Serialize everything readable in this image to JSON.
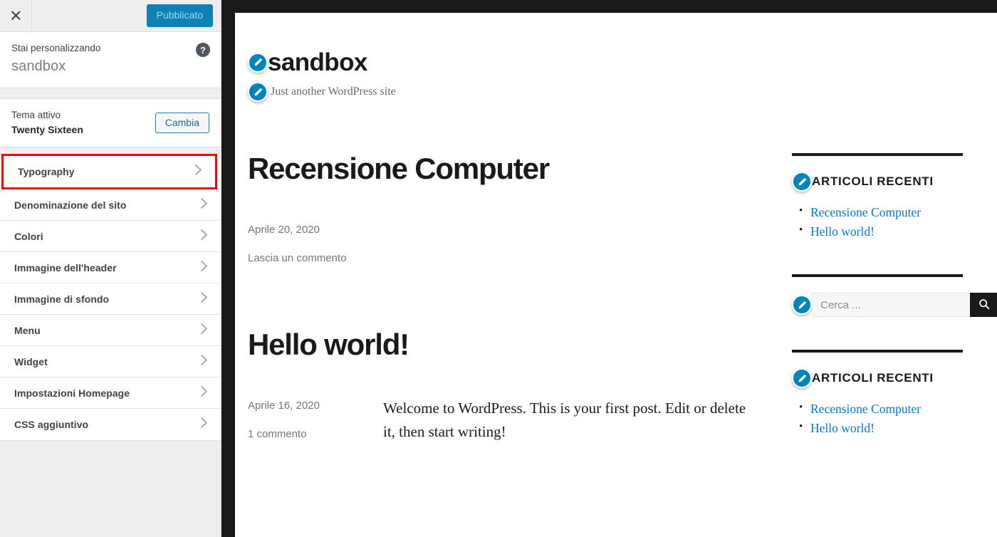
{
  "customizer": {
    "close_label": "×",
    "close_icon": "close-icon",
    "publish_label": "Pubblicato",
    "info": {
      "label": "Stai personalizzando",
      "site_title": "sandbox",
      "help_glyph": "?"
    },
    "theme": {
      "label": "Tema attivo",
      "name": "Twenty Sixteen",
      "change_label": "Cambia"
    },
    "menu_items": [
      {
        "label": "Typography",
        "highlighted": true
      },
      {
        "label": "Denominazione del sito",
        "highlighted": false
      },
      {
        "label": "Colori",
        "highlighted": false
      },
      {
        "label": "Immagine dell'header",
        "highlighted": false
      },
      {
        "label": "Immagine di sfondo",
        "highlighted": false
      },
      {
        "label": "Menu",
        "highlighted": false
      },
      {
        "label": "Widget",
        "highlighted": false
      },
      {
        "label": "Impostazioni Homepage",
        "highlighted": false
      },
      {
        "label": "CSS aggiuntivo",
        "highlighted": false
      }
    ],
    "highlight_color": "#ff0000",
    "publish_button_color": "#0e82b6",
    "accent_color": "#0085ba"
  },
  "preview": {
    "site": {
      "title": "sandbox",
      "description": "Just another WordPress site"
    },
    "posts": [
      {
        "title": "Recensione Computer",
        "date": "Aprile 20, 2020",
        "comments": "Lascia un commento",
        "excerpt": ""
      },
      {
        "title": "Hello world!",
        "date": "Aprile 16, 2020",
        "comments": "1 commento",
        "excerpt": "Welcome to WordPress. This is your first post. Edit or delete it, then start writing!"
      }
    ],
    "widgets": [
      {
        "type": "recent-posts",
        "title": "ARTICOLI RECENTI",
        "links": [
          "Recensione Computer",
          "Hello world!"
        ]
      },
      {
        "type": "search",
        "placeholder": "Cerca ...",
        "value": "",
        "search_icon": "search-icon"
      },
      {
        "type": "recent-posts",
        "title": "ARTICOLI RECENTI",
        "links": [
          "Recensione Computer",
          "Hello world!"
        ]
      }
    ],
    "link_color": "#007acc"
  }
}
